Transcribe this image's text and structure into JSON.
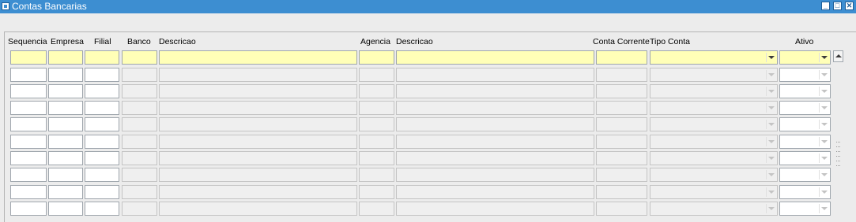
{
  "window": {
    "title": "Contas Bancarias",
    "buttons": [
      "minimize",
      "maximize",
      "close"
    ]
  },
  "columns": [
    "Sequencia",
    "Empresa",
    "Filial",
    "Banco",
    "Descricao",
    "Agencia",
    "Descricao",
    "Conta Corrente",
    "Tipo Conta",
    "Ativo"
  ],
  "rows": [
    {
      "sequencia": "",
      "empresa": "",
      "filial": "",
      "banco": "",
      "descricao_banco": "",
      "agencia": "",
      "descricao_agencia": "",
      "conta_corrente": "",
      "tipo_conta": "",
      "ativo": ""
    },
    {
      "sequencia": "",
      "empresa": "",
      "filial": "",
      "banco": "",
      "descricao_banco": "",
      "agencia": "",
      "descricao_agencia": "",
      "conta_corrente": "",
      "tipo_conta": "",
      "ativo": ""
    },
    {
      "sequencia": "",
      "empresa": "",
      "filial": "",
      "banco": "",
      "descricao_banco": "",
      "agencia": "",
      "descricao_agencia": "",
      "conta_corrente": "",
      "tipo_conta": "",
      "ativo": ""
    },
    {
      "sequencia": "",
      "empresa": "",
      "filial": "",
      "banco": "",
      "descricao_banco": "",
      "agencia": "",
      "descricao_agencia": "",
      "conta_corrente": "",
      "tipo_conta": "",
      "ativo": ""
    },
    {
      "sequencia": "",
      "empresa": "",
      "filial": "",
      "banco": "",
      "descricao_banco": "",
      "agencia": "",
      "descricao_agencia": "",
      "conta_corrente": "",
      "tipo_conta": "",
      "ativo": ""
    },
    {
      "sequencia": "",
      "empresa": "",
      "filial": "",
      "banco": "",
      "descricao_banco": "",
      "agencia": "",
      "descricao_agencia": "",
      "conta_corrente": "",
      "tipo_conta": "",
      "ativo": ""
    },
    {
      "sequencia": "",
      "empresa": "",
      "filial": "",
      "banco": "",
      "descricao_banco": "",
      "agencia": "",
      "descricao_agencia": "",
      "conta_corrente": "",
      "tipo_conta": "",
      "ativo": ""
    },
    {
      "sequencia": "",
      "empresa": "",
      "filial": "",
      "banco": "",
      "descricao_banco": "",
      "agencia": "",
      "descricao_agencia": "",
      "conta_corrente": "",
      "tipo_conta": "",
      "ativo": ""
    },
    {
      "sequencia": "",
      "empresa": "",
      "filial": "",
      "banco": "",
      "descricao_banco": "",
      "agencia": "",
      "descricao_agencia": "",
      "conta_corrente": "",
      "tipo_conta": "",
      "ativo": ""
    },
    {
      "sequencia": "",
      "empresa": "",
      "filial": "",
      "banco": "",
      "descricao_banco": "",
      "agencia": "",
      "descricao_agencia": "",
      "conta_corrente": "",
      "tipo_conta": "",
      "ativo": ""
    }
  ],
  "current_row": 0,
  "colors": {
    "titlebar": "#3d8ed1",
    "current_record": "#ffffb7",
    "disabled_field": "#efefef",
    "enabled_field": "#ffffff"
  },
  "icons": [
    "app-icon",
    "minimize-icon",
    "maximize-icon",
    "close-icon",
    "chevron-down-icon",
    "scroll-up-icon"
  ]
}
